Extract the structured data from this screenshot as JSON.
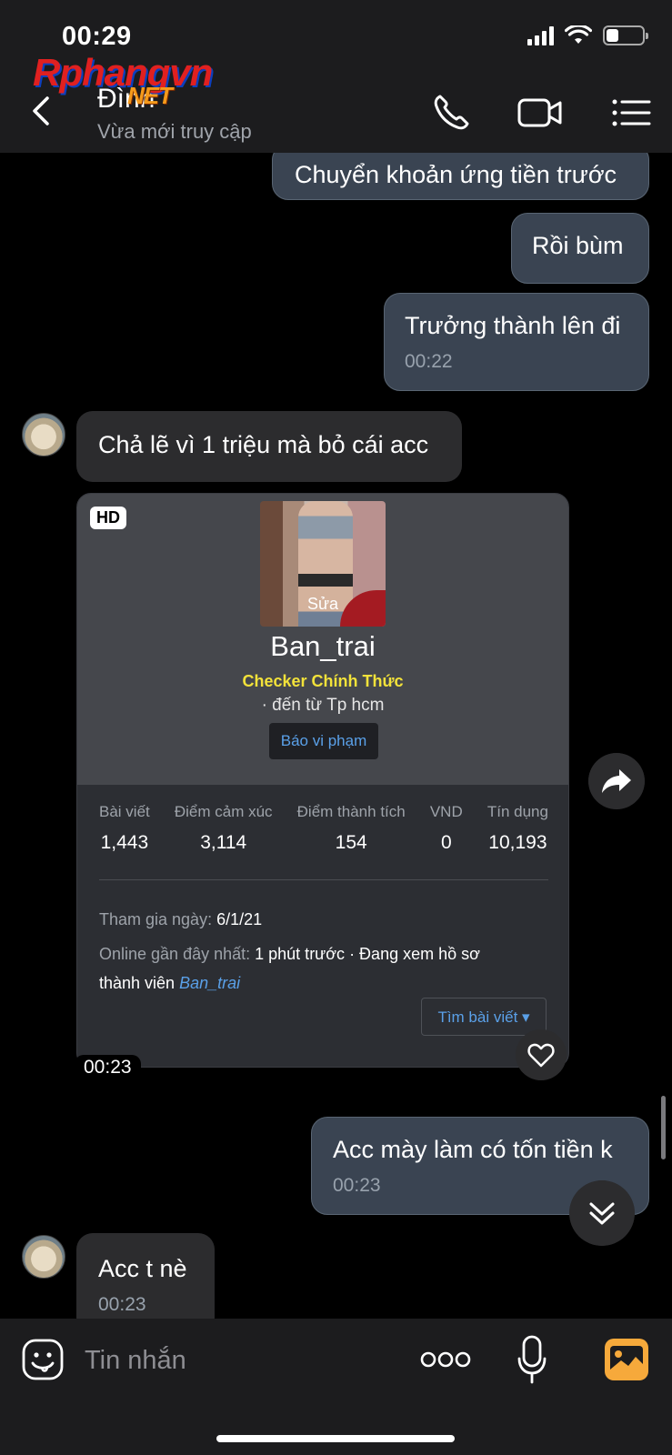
{
  "status_bar": {
    "time": "00:29"
  },
  "watermark": {
    "text": "Rphangvn",
    "suffix": "NET"
  },
  "header": {
    "contact_name": "Đình",
    "contact_status": "Vừa mới truy cập"
  },
  "messages": [
    {
      "direction": "out",
      "text": "Chuyển khoản ứng tiền trước",
      "time": ""
    },
    {
      "direction": "out",
      "text": "Rồi bùm",
      "time": ""
    },
    {
      "direction": "out",
      "text": "Trưởng thành lên đi",
      "time": "00:22"
    },
    {
      "direction": "in",
      "text": "Chả lẽ vì 1 triệu mà bỏ cái acc",
      "time": ""
    },
    {
      "direction": "out",
      "text": "Acc mày làm có tốn tiền k",
      "time": "00:23"
    },
    {
      "direction": "in",
      "text": "Acc t nè",
      "time": "00:23"
    }
  ],
  "profile_card": {
    "badge": "HD",
    "photo_label": "Sửa",
    "username": "Ban_trai",
    "title": "Checker Chính Thức",
    "location": "· đến từ Tp hcm",
    "report_label": "Báo vi phạm",
    "stats": [
      {
        "label": "Bài viết",
        "value": "1,443"
      },
      {
        "label": "Điểm cảm xúc",
        "value": "3,114"
      },
      {
        "label": "Điểm thành tích",
        "value": "154"
      },
      {
        "label": "VND",
        "value": "0"
      },
      {
        "label": "Tín dụng",
        "value": "10,193"
      }
    ],
    "joined_label": "Tham gia ngày:",
    "joined_value": "6/1/21",
    "online_label": "Online gần đây nhất:",
    "online_value": "1 phút trước",
    "online_activity": "· Đang xem hồ sơ",
    "online_activity_2": "thành viên",
    "online_link": "Ban_trai",
    "search_posts_label": "Tìm bài viết ▾",
    "time": "00:23"
  },
  "input_bar": {
    "placeholder": "Tin nhắn"
  }
}
